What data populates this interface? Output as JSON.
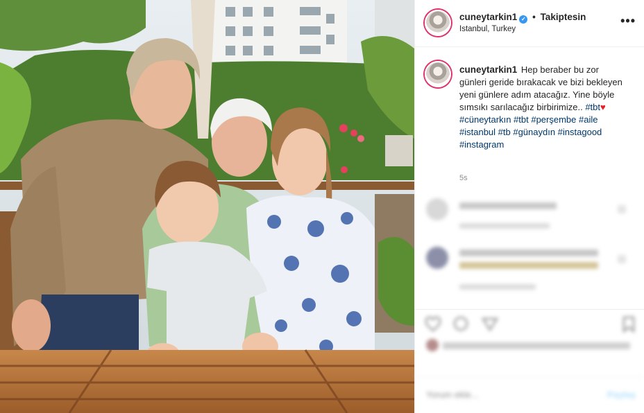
{
  "post": {
    "username": "cuneytarkin1",
    "verified_mark": "✓",
    "separator": "•",
    "follow_label": "Takiptesin",
    "location": "Istanbul, Turkey",
    "more_icon": "more-options-icon",
    "more_glyph": "•••",
    "time_ago": "5s"
  },
  "caption": {
    "username": "cuneytarkin1",
    "text": "Hep beraber bu zor günleri geride bırakacak ve bizi bekleyen yeni günlere adım atacağız. Yine böyle sımsıkı sarılacağız birbirimize.. ",
    "inline_tag": "#tbt",
    "heart": "♥",
    "hashtags": "#cüneytarkın #tbt #perşembe #aile #istanbul #tb #günaydın #instagood #instagram"
  },
  "comment_box": {
    "placeholder": "Yorum ekle...",
    "post_label": "Paylaş"
  },
  "colors": {
    "link": "#00376b",
    "verified": "#3897f0",
    "muted": "#8e8e8e",
    "heart": "#ed1c24"
  }
}
